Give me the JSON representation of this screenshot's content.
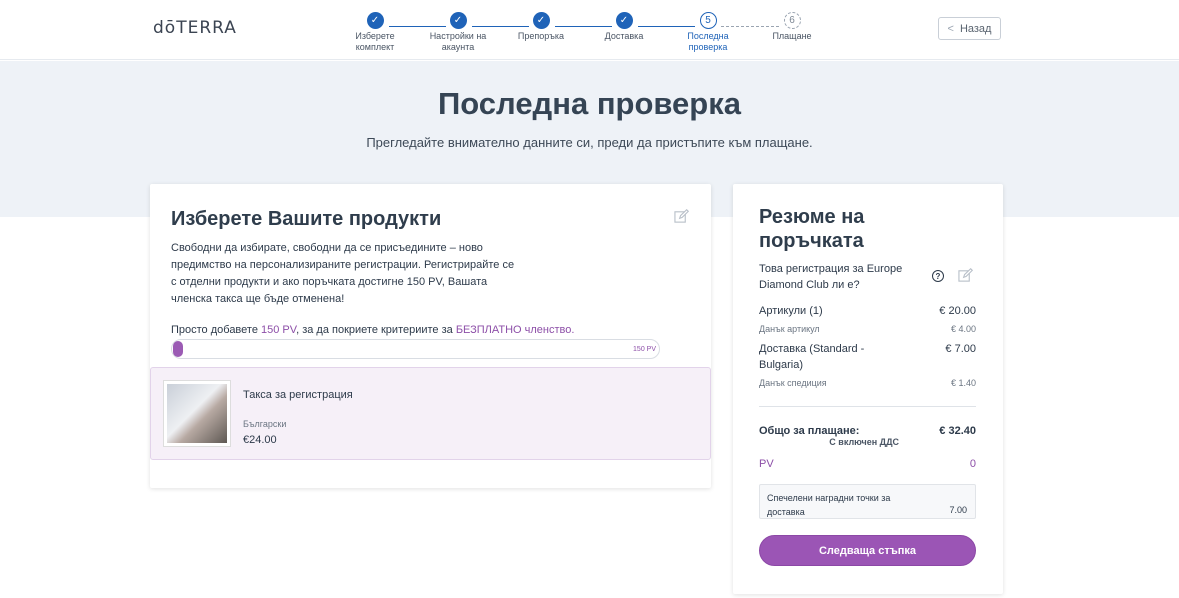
{
  "brand": {
    "logo_pre": "d",
    "logo_o": "ō",
    "logo_post": "TERRA"
  },
  "steps": [
    {
      "label": "Изберете комплект",
      "state": "done",
      "number": ""
    },
    {
      "label": "Настройки на акаунта",
      "state": "done",
      "number": ""
    },
    {
      "label": "Препоръка",
      "state": "done",
      "number": ""
    },
    {
      "label": "Доставка",
      "state": "done",
      "number": ""
    },
    {
      "label": "Последна проверка",
      "state": "current",
      "number": "5"
    },
    {
      "label": "Плащане",
      "state": "future",
      "number": "6"
    }
  ],
  "header": {
    "back_label": "Назад"
  },
  "hero": {
    "title": "Последна проверка",
    "subtitle": "Прегледайте внимателно данните си, преди да пристъпите към плащане."
  },
  "products": {
    "title": "Изберете Вашите продукти",
    "description": "Свободни да избирате, свободни да се присъедините – ново предимство на персонализираните регистрации. Регистрирайте се с отделни продукти и ако поръчката достигне 150 PV, Вашата членска такса ще бъде отменена!",
    "note_prefix": "Просто добавете ",
    "note_pv": "150 PV",
    "note_mid": ", за да покриете критериите за ",
    "note_free": "БЕЗПЛАТНО членство.",
    "progress_label": "150 PV",
    "progress_fraction": 0.02,
    "item": {
      "title": "Такса за регистрация",
      "language": "Български",
      "price": "€24.00"
    }
  },
  "summary": {
    "title": "Резюме на поръчката",
    "question": "Това регистрация за Europe Diamond Club ли е?",
    "help_glyph": "?",
    "rows": {
      "items_label": "Артикули (1)",
      "items_value": "€ 20.00",
      "items_tax_label": "Данък артикул",
      "items_tax_value": "€ 4.00",
      "shipping_label": "Доставка (Standard - Bulgaria)",
      "shipping_value": "€ 7.00",
      "shipping_tax_label": "Данък спедиция",
      "shipping_tax_value": "€ 1.40",
      "total_label": "Общо за плащане:",
      "total_value": "€ 32.40",
      "vat_note": "С включен ДДС",
      "pv_label": "PV",
      "pv_value": "0"
    },
    "points_label": "Спечелени наградни точки за доставка",
    "points_value": "7.00",
    "next_label": "Следваща стъпка"
  },
  "colors": {
    "primary_blue": "#1f63b8",
    "accent_purple": "#9b55b5",
    "hero_bg": "#eef2f7"
  }
}
